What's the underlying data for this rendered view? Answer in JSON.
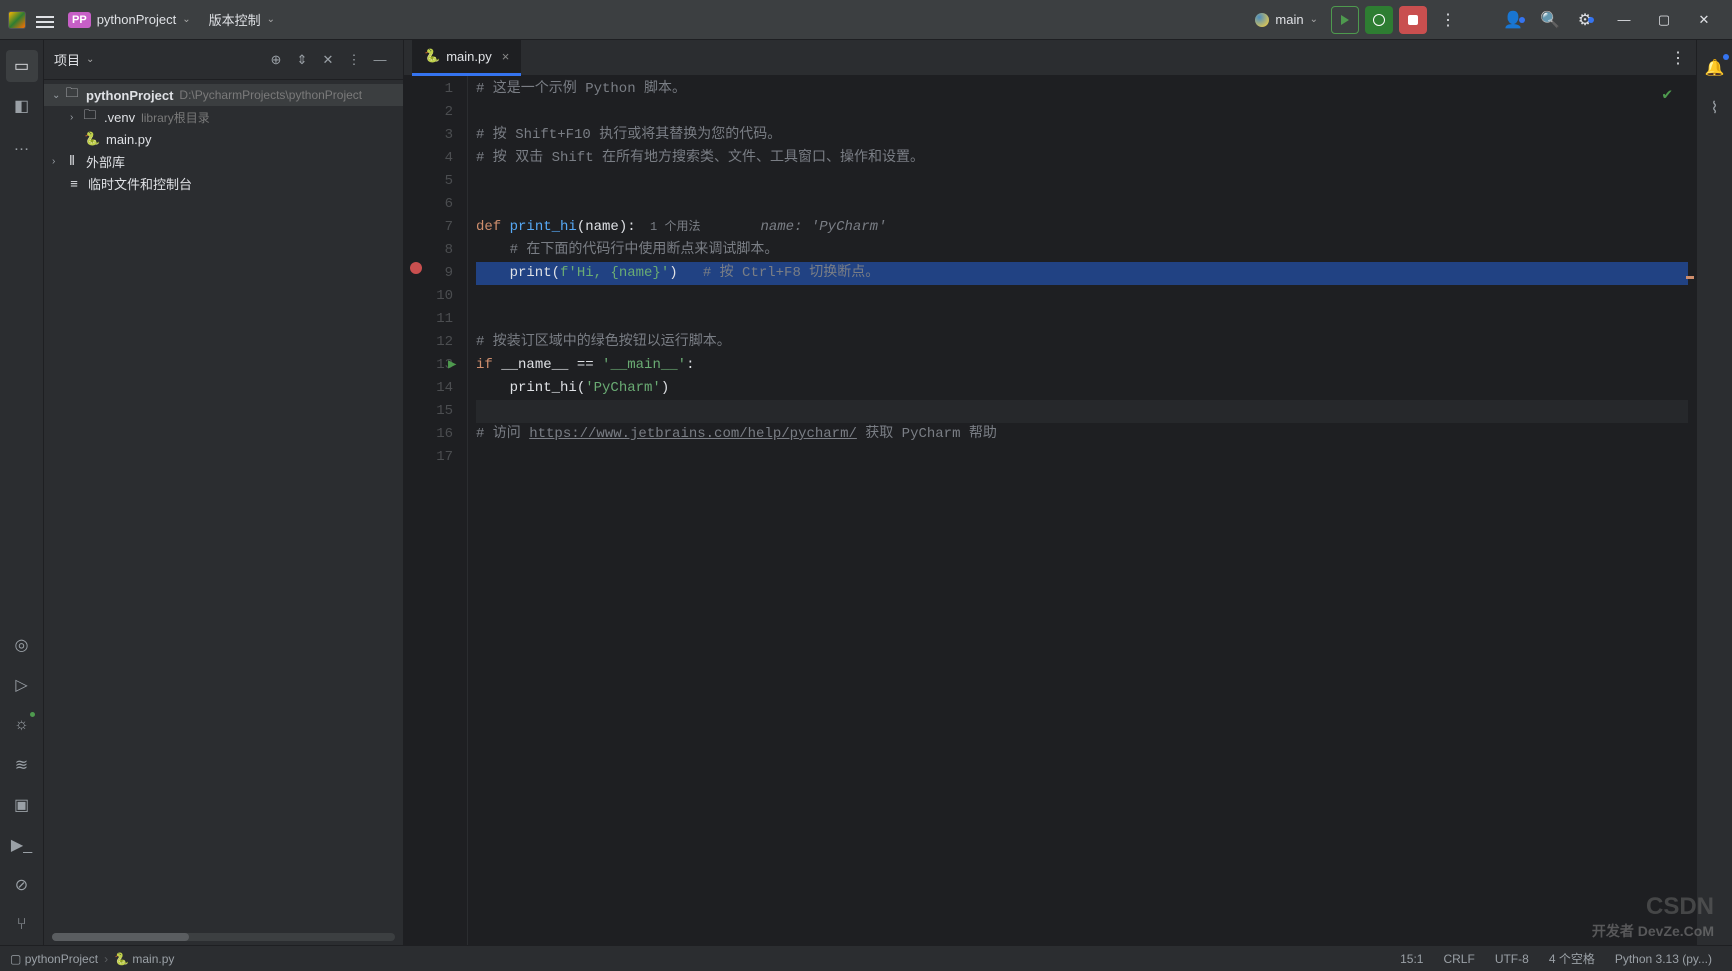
{
  "titlebar": {
    "project_badge": "PP",
    "project_name": "pythonProject",
    "vcs_menu": "版本控制",
    "run_config": "main"
  },
  "sidebar": {
    "title": "项目",
    "tree": {
      "root": {
        "name": "pythonProject",
        "path": "D:\\PycharmProjects\\pythonProject"
      },
      "venv": {
        "name": ".venv",
        "hint": "library根目录"
      },
      "main": {
        "name": "main.py"
      },
      "external": {
        "name": "外部库"
      },
      "scratch": {
        "name": "临时文件和控制台"
      }
    }
  },
  "editor": {
    "tab_label": "main.py",
    "lines": {
      "l1": "# 这是一个示例 Python 脚本。",
      "l3": "# 按 Shift+F10 执行或将其替换为您的代码。",
      "l4": "# 按 双击 Shift 在所有地方搜索类、文件、工具窗口、操作和设置。",
      "l7_def": "def ",
      "l7_fn": "print_hi",
      "l7_rest": "(name):",
      "l7_usage": "  1 个用法",
      "l7_hint": "name: 'PyCharm'",
      "l8": "    # 在下面的代码行中使用断点来调试脚本。",
      "l9_a": "    print(",
      "l9_b": "f'Hi, {name}'",
      "l9_c": ")   ",
      "l9_d": "# 按 Ctrl+F8 切换断点。",
      "l12": "# 按装订区域中的绿色按钮以运行脚本。",
      "l13_a": "if ",
      "l13_b": "__name__ == ",
      "l13_c": "'__main__'",
      "l13_d": ":",
      "l14_a": "    print_hi(",
      "l14_b": "'PyCharm'",
      "l14_c": ")",
      "l16_a": "# 访问 ",
      "l16_b": "https://www.jetbrains.com/help/pycharm/",
      "l16_c": " 获取 PyCharm 帮助"
    },
    "gutter_numbers": [
      "1",
      "2",
      "3",
      "4",
      "5",
      "6",
      "7",
      "8",
      "9",
      "10",
      "11",
      "12",
      "13",
      "14",
      "15",
      "16",
      "17"
    ]
  },
  "statusbar": {
    "crumb1": "pythonProject",
    "crumb2": "main.py",
    "pos": "15:1",
    "eol": "CRLF",
    "encoding": "UTF-8",
    "indent": "4 个空格",
    "interpreter": "Python 3.13 (py...)"
  },
  "watermark": {
    "main": "CSDN",
    "sub": "开发者\nDevZe.CoM"
  }
}
